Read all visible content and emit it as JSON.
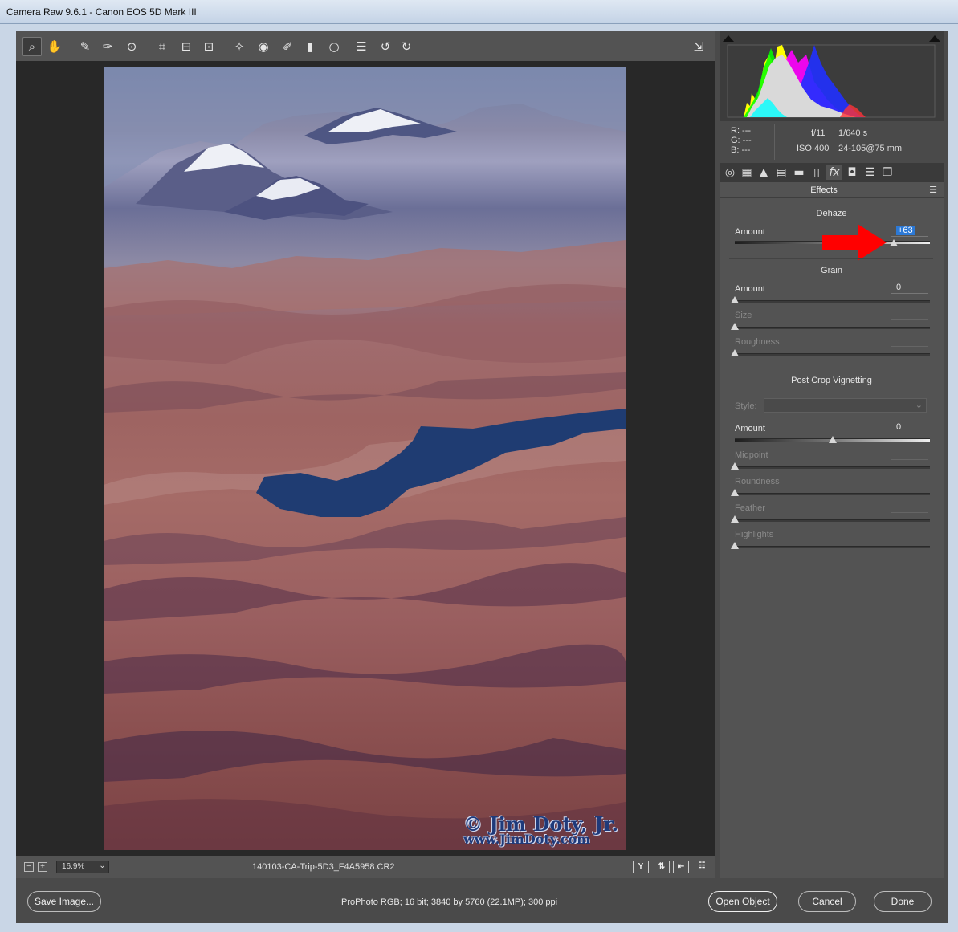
{
  "window": {
    "title": "Camera Raw 9.6.1  -  Canon EOS 5D Mark III"
  },
  "toolbar": {
    "tools": [
      {
        "name": "zoom-tool-icon",
        "glyph": "⌕"
      },
      {
        "name": "hand-tool-icon",
        "glyph": "✋"
      },
      {
        "name": "white-balance-tool-icon",
        "glyph": "✎"
      },
      {
        "name": "color-sampler-tool-icon",
        "glyph": "✑"
      },
      {
        "name": "targeted-adjustment-tool-icon",
        "glyph": "⊙"
      },
      {
        "name": "crop-tool-icon",
        "glyph": "⌗"
      },
      {
        "name": "straighten-tool-icon",
        "glyph": "⊟"
      },
      {
        "name": "transform-tool-icon",
        "glyph": "⊡"
      },
      {
        "name": "spot-removal-tool-icon",
        "glyph": "✧"
      },
      {
        "name": "red-eye-removal-tool-icon",
        "glyph": "◉"
      },
      {
        "name": "adjustment-brush-tool-icon",
        "glyph": "✐"
      },
      {
        "name": "graduated-filter-tool-icon",
        "glyph": "▮"
      },
      {
        "name": "radial-filter-tool-icon",
        "glyph": "○"
      },
      {
        "name": "preferences-icon",
        "glyph": "☰"
      },
      {
        "name": "rotate-left-icon",
        "glyph": "↺"
      },
      {
        "name": "rotate-right-icon",
        "glyph": "↻"
      }
    ],
    "fullscreen_glyph": "⇲"
  },
  "preview": {
    "watermark_line1": "© Jim Doty, Jr.",
    "watermark_line2": "www.JimDoty.com"
  },
  "statusbar": {
    "zoom_out": "−",
    "zoom_in": "+",
    "zoom_value": "16.9%",
    "zoom_chevron": "⌄",
    "filename": "140103-CA-Trip-5D3_F4A5958.CR2",
    "icons": [
      "Y",
      "⇅",
      "⇤",
      "☷"
    ]
  },
  "info": {
    "r": "R:   ---",
    "g": "G:   ---",
    "b": "B:   ---",
    "aperture": "f/11",
    "shutter": "1/640 s",
    "iso": "ISO 400",
    "lens": "24-105@75 mm"
  },
  "tabs": [
    "◎",
    "▦",
    "▲",
    "▤",
    "▬",
    "▯",
    "fx",
    "◘",
    "☰",
    "❐"
  ],
  "panel": {
    "title": "Effects",
    "menu_glyph": "☰",
    "dehaze": {
      "title": "Dehaze",
      "amount_label": "Amount",
      "amount_value": "+63",
      "amount": 63,
      "range": [
        -100,
        100
      ]
    },
    "grain": {
      "title": "Grain",
      "amount_label": "Amount",
      "amount_value": "0",
      "amount": 0,
      "range": [
        0,
        100
      ],
      "size_label": "Size",
      "roughness_label": "Roughness"
    },
    "vignetting": {
      "title": "Post Crop Vignetting",
      "style_label": "Style:",
      "style_chevron": "⌄",
      "amount_label": "Amount",
      "amount_value": "0",
      "amount": 0,
      "range": [
        -100,
        100
      ],
      "midpoint_label": "Midpoint",
      "roundness_label": "Roundness",
      "feather_label": "Feather",
      "highlights_label": "Highlights"
    }
  },
  "bottom": {
    "save": "Save Image...",
    "workflow": "ProPhoto RGB; 16 bit; 3840 by 5760 (22.1MP); 300 ppi",
    "open": "Open Object",
    "cancel": "Cancel",
    "done": "Done"
  }
}
